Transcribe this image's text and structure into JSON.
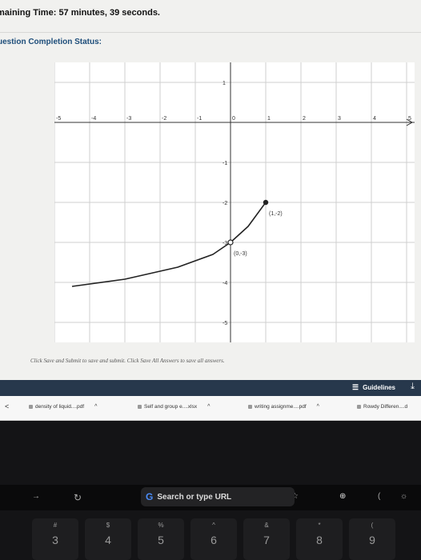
{
  "header": {
    "timer_label": "maining Time:",
    "timer_value": "57 minutes, 39 seconds.",
    "status_label": "uestion Completion Status:"
  },
  "graph": {
    "x_ticks": [
      "-5",
      "-4",
      "-3",
      "-2",
      "-1",
      "0",
      "1",
      "2",
      "3",
      "4",
      "5"
    ],
    "y_ticks": [
      "1",
      "-1",
      "-2",
      "-3",
      "-4",
      "-5"
    ],
    "x_range": [
      -5,
      5
    ],
    "y_range": [
      -5.5,
      1.5
    ],
    "curve": {
      "points": [
        [
          -4.5,
          -4.1
        ],
        [
          -3,
          -3.92
        ],
        [
          -1.5,
          -3.62
        ],
        [
          -0.5,
          -3.3
        ],
        [
          0,
          -3
        ],
        [
          0.5,
          -2.6
        ],
        [
          1,
          -2
        ]
      ],
      "open_point": [
        0,
        -3
      ],
      "closed_point": [
        1,
        -2
      ]
    },
    "labels": [
      {
        "text": "(1,-2)",
        "at": [
          1,
          -2
        ]
      },
      {
        "text": "(0,-3)",
        "at": [
          0,
          -3
        ]
      }
    ],
    "line_color": "#222222",
    "grid_color": "#cfcfcf"
  },
  "instructions": "Click Save and Submit to save and submit. Click Save All Answers to save all answers.",
  "guidelines_label": "Guidelines",
  "downloads": [
    {
      "name": "density of liquid....pdf"
    },
    {
      "name": "Self and group e....xlsx"
    },
    {
      "name": "writing assignme....pdf"
    },
    {
      "name": "Rowdy Differen....d"
    }
  ],
  "touchbar": {
    "search_placeholder": "Search or type URL"
  },
  "keys": [
    {
      "sym": "#",
      "num": "3"
    },
    {
      "sym": "$",
      "num": "4"
    },
    {
      "sym": "%",
      "num": "5"
    },
    {
      "sym": "^",
      "num": "6"
    },
    {
      "sym": "&",
      "num": "7"
    },
    {
      "sym": "*",
      "num": "8"
    },
    {
      "sym": "(",
      "num": "9"
    }
  ]
}
